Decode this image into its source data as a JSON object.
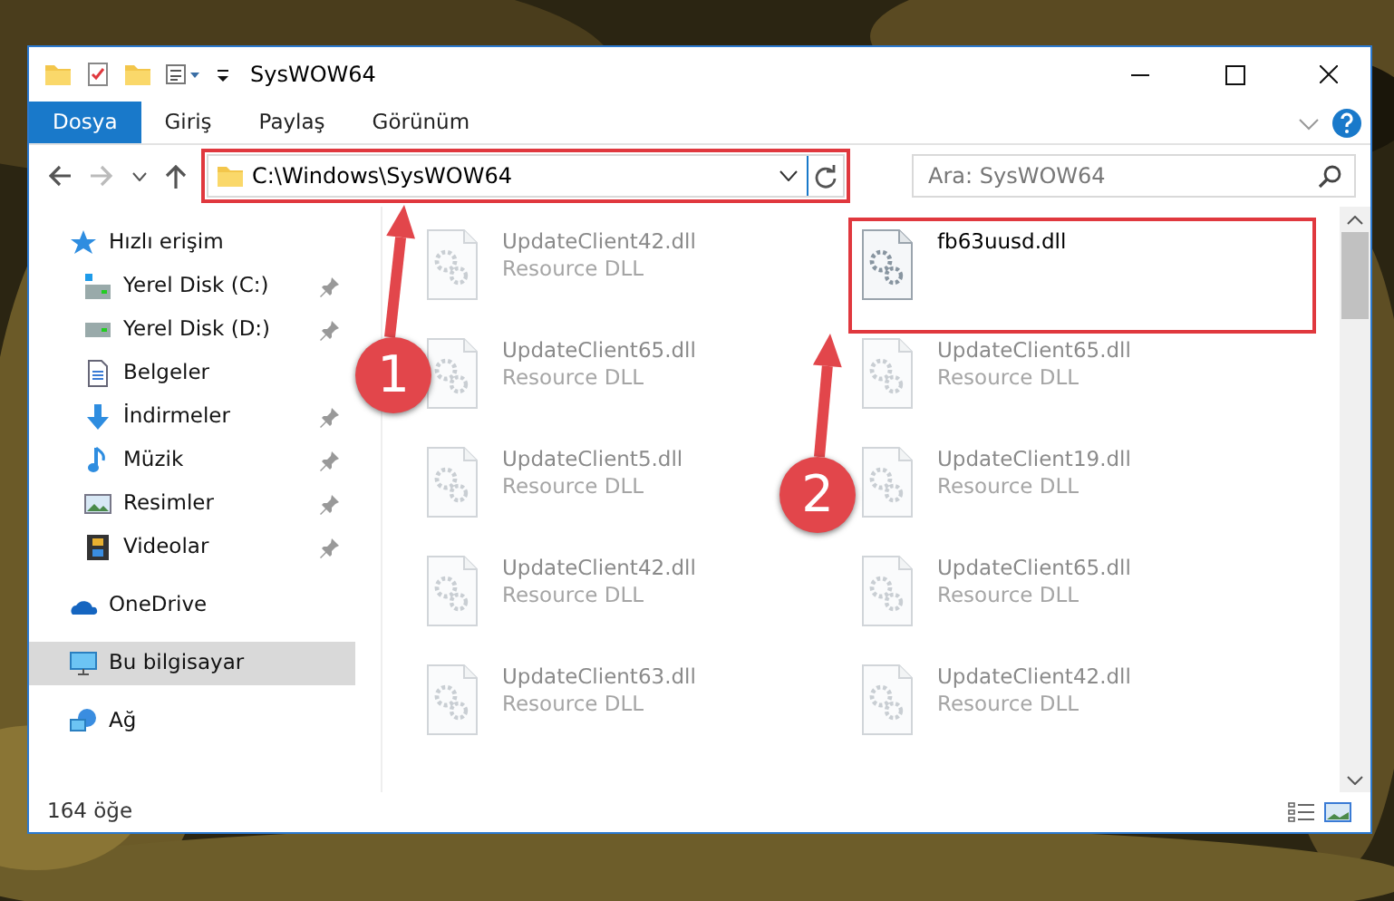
{
  "window": {
    "title": "SysWOW64"
  },
  "ribbon_tabs": [
    {
      "label": "Dosya",
      "selected": true
    },
    {
      "label": "Giriş",
      "selected": false
    },
    {
      "label": "Paylaş",
      "selected": false
    },
    {
      "label": "Görünüm",
      "selected": false
    }
  ],
  "address": {
    "path": "C:\\Windows\\SysWOW64",
    "highlighted": true
  },
  "search": {
    "placeholder": "Ara: SysWOW64"
  },
  "sidebar": {
    "items": [
      {
        "label": "Hızlı erişim",
        "kind": "star",
        "selected": false,
        "children": [
          {
            "label": "Yerel Disk (C:)",
            "kind": "system-drive",
            "pinned": true,
            "selected": false
          },
          {
            "label": "Yerel Disk (D:)",
            "kind": "drive",
            "pinned": true,
            "selected": false
          },
          {
            "label": "Belgeler",
            "kind": "document",
            "pinned": false,
            "selected": false
          },
          {
            "label": "İndirmeler",
            "kind": "download",
            "pinned": true,
            "selected": false
          },
          {
            "label": "Müzik",
            "kind": "music",
            "pinned": true,
            "selected": false
          },
          {
            "label": "Resimler",
            "kind": "pictures",
            "pinned": true,
            "selected": false
          },
          {
            "label": "Videolar",
            "kind": "video",
            "pinned": true,
            "selected": false
          }
        ]
      },
      {
        "label": "OneDrive",
        "kind": "cloud",
        "selected": false
      },
      {
        "label": "Bu bilgisayar",
        "kind": "computer",
        "selected": true
      },
      {
        "label": "Ağ",
        "kind": "network",
        "selected": false
      }
    ]
  },
  "files": [
    {
      "name": "UpdateClient42.dll",
      "type": "Resource DLL",
      "dimmed": true,
      "highlighted": false
    },
    {
      "name": "fb63uusd.dll",
      "dimmed": false,
      "highlighted": true
    },
    {
      "name": "UpdateClient65.dll",
      "type": "Resource DLL",
      "dimmed": true,
      "highlighted": false
    },
    {
      "name": "UpdateClient65.dll",
      "type": "Resource DLL",
      "dimmed": true,
      "highlighted": false
    },
    {
      "name": "UpdateClient5.dll",
      "type": "Resource DLL",
      "dimmed": true,
      "highlighted": false
    },
    {
      "name": "UpdateClient19.dll",
      "type": "Resource DLL",
      "dimmed": true,
      "highlighted": false
    },
    {
      "name": "UpdateClient42.dll",
      "type": "Resource DLL",
      "dimmed": true,
      "highlighted": false
    },
    {
      "name": "UpdateClient65.dll",
      "type": "Resource DLL",
      "dimmed": true,
      "highlighted": false
    },
    {
      "name": "UpdateClient63.dll",
      "type": "Resource DLL",
      "dimmed": true,
      "highlighted": false
    },
    {
      "name": "UpdateClient42.dll",
      "type": "Resource DLL",
      "dimmed": true,
      "highlighted": false
    }
  ],
  "status_bar": {
    "item_count": "164 öğe"
  },
  "annotations": [
    {
      "label": "1"
    },
    {
      "label": "2"
    }
  ]
}
